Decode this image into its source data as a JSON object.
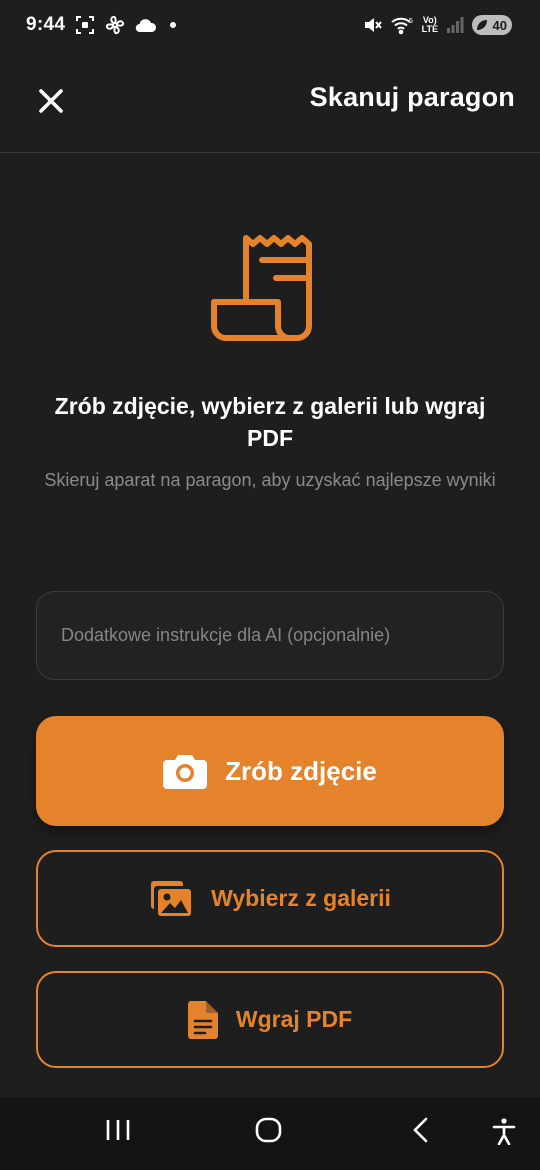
{
  "status_bar": {
    "time": "9:44",
    "battery": "40",
    "volte_top": "Vo)",
    "volte_bottom": "LTE",
    "network": "5"
  },
  "header": {
    "title": "Skanuj paragon",
    "close_icon": "close-icon"
  },
  "hero": {
    "icon": "receipt-icon",
    "title": "Zrób zdjęcie, wybierz z galerii lub wgraj PDF",
    "subtitle": "Skieruj aparat na paragon, aby uzyskać najlepsze wyniki"
  },
  "instructions": {
    "placeholder": "Dodatkowe instrukcje dla AI (opcjonalnie)",
    "value": ""
  },
  "actions": {
    "take_photo": "Zrób zdjęcie",
    "gallery": "Wybierz z galerii",
    "upload_pdf": "Wgraj PDF"
  },
  "colors": {
    "accent": "#e5832d",
    "background": "#1e1e1e",
    "muted_text": "#8a8a8a"
  }
}
